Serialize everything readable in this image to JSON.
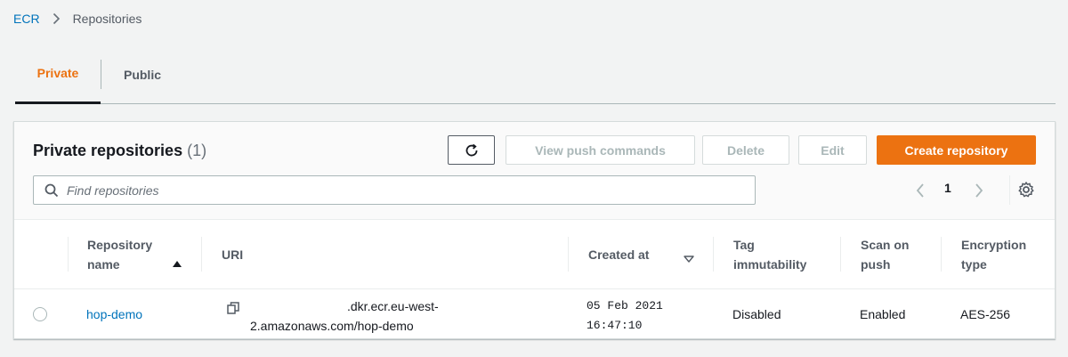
{
  "breadcrumb": {
    "root": "ECR",
    "current": "Repositories"
  },
  "tabs": {
    "private": "Private",
    "public": "Public"
  },
  "panel": {
    "title": "Private repositories",
    "count": "(1)",
    "buttons": {
      "view_push": "View push commands",
      "delete": "Delete",
      "edit": "Edit",
      "create": "Create repository"
    },
    "search_placeholder": "Find repositories",
    "page": "1"
  },
  "table": {
    "columns": {
      "name_line1": "Repository",
      "name_line2": "name",
      "uri": "URI",
      "created": "Created at",
      "tag_line1": "Tag",
      "tag_line2": "immutability",
      "scan_line1": "Scan on",
      "scan_line2": "push",
      "enc_line1": "Encryption",
      "enc_line2": "type"
    },
    "rows": [
      {
        "name": "hop-demo",
        "uri_line1": ".dkr.ecr.eu-west-",
        "uri_line2": "2.amazonaws.com/hop-demo",
        "created_line1": "05 Feb 2021",
        "created_line2": "16:47:10",
        "tag_immutability": "Disabled",
        "scan_on_push": "Enabled",
        "encryption": "AES-256"
      }
    ]
  },
  "colors": {
    "accent": "#ec7211",
    "link": "#0073bb",
    "text": "#16191f",
    "muted": "#545b64"
  }
}
